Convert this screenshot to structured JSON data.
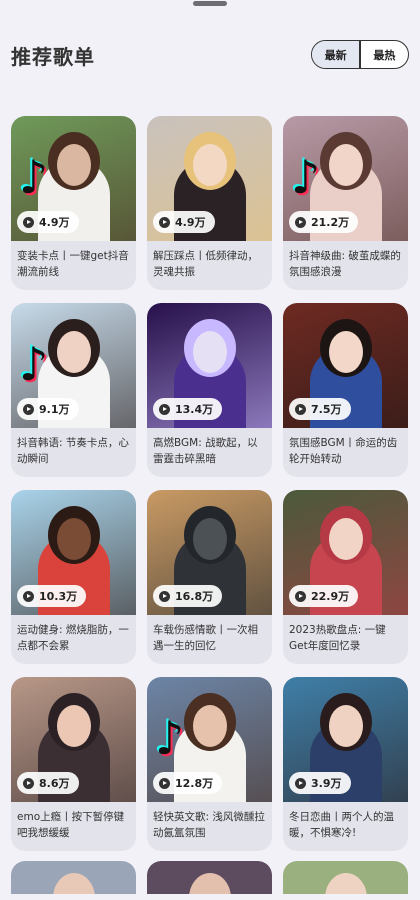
{
  "header": {
    "title": "推荐歌单",
    "sort_options": [
      "最新",
      "最热"
    ],
    "active_sort": "最新"
  },
  "playlists": [
    {
      "plays": "4.9万",
      "title": "变装卡点丨一键get抖音潮流前线",
      "palette": {
        "bg": "#6f9a5a",
        "fig": "#f2f0ec",
        "head": "#d9b7a0",
        "hair": "#4a2e22"
      },
      "logo": true
    },
    {
      "plays": "4.9万",
      "title": "解压踩点丨低频律动，灵魂共振",
      "palette": {
        "bg": "#c9c2bd",
        "fig": "#2a2224",
        "head": "#f3d9c4",
        "hair": "#e7c27a"
      },
      "logo": false
    },
    {
      "plays": "21.2万",
      "title": "抖音神级曲: 破茧成蝶的氛围感浪漫",
      "palette": {
        "bg": "#b79aa6",
        "fig": "#e9cfc7",
        "head": "#f1d5c8",
        "hair": "#5a3a33"
      },
      "logo": true
    },
    {
      "plays": "9.1万",
      "title": "抖音韩语: 节奏卡点，心动瞬间",
      "palette": {
        "bg": "#c7dbea",
        "fig": "#f4f4f4",
        "head": "#f0d2c4",
        "hair": "#2b1f1d"
      },
      "logo": true
    },
    {
      "plays": "13.4万",
      "title": "高燃BGM: 战歌起，以雷霆击碎黑暗",
      "palette": {
        "bg": "#27104a",
        "fig": "#4b2f8e",
        "head": "#e6e0f5",
        "hair": "#c8b8ff"
      },
      "logo": false
    },
    {
      "plays": "7.5万",
      "title": "氛围感BGM丨命运的齿轮开始转动",
      "palette": {
        "bg": "#6e2a22",
        "fig": "#2f4f9e",
        "head": "#f3d7c9",
        "hair": "#1d1514"
      },
      "logo": false
    },
    {
      "plays": "10.3万",
      "title": "运动健身: 燃烧脂肪，一点都不会累",
      "palette": {
        "bg": "#a9d3ea",
        "fig": "#d9433b",
        "head": "#7a4c35",
        "hair": "#2b1b14"
      },
      "logo": false
    },
    {
      "plays": "16.8万",
      "title": "车载伤感情歌丨一次相遇一生的回忆",
      "palette": {
        "bg": "#c99a64",
        "fig": "#2f3337",
        "head": "#4c5156",
        "hair": "#23272b"
      },
      "logo": false
    },
    {
      "plays": "22.9万",
      "title": "2023热歌盘点: 一键Get年度回忆录",
      "palette": {
        "bg": "#4b5a3c",
        "fig": "#c7454e",
        "head": "#f2d4c6",
        "hair": "#b63a45"
      },
      "logo": false
    },
    {
      "plays": "8.6万",
      "title": "emo上瘾丨按下暂停键吧我想缓缓",
      "palette": {
        "bg": "#b89888",
        "fig": "#3b2f33",
        "head": "#ebc7b4",
        "hair": "#2c2226"
      },
      "logo": false
    },
    {
      "plays": "12.8万",
      "title": "轻快英文歌: 浅风微醺拉动氤氲氛围",
      "palette": {
        "bg": "#6c85a6",
        "fig": "#f4f2ee",
        "head": "#e6c1ab",
        "hair": "#4a2f22"
      },
      "logo": true
    },
    {
      "plays": "3.9万",
      "title": "冬日恋曲丨两个人的温暖，不惧寒冷!",
      "palette": {
        "bg": "#3f7fa8",
        "fig": "#2c3f68",
        "head": "#f0d2c2",
        "hair": "#2a1c1c"
      },
      "logo": false
    }
  ],
  "partial_row": [
    {
      "palette": {
        "bg": "#9aa6b8",
        "head": "#e8c8b6"
      }
    },
    {
      "palette": {
        "bg": "#5d4c60",
        "head": "#e2c0ad"
      }
    },
    {
      "palette": {
        "bg": "#9ab07e",
        "head": "#efd3c2"
      }
    }
  ]
}
